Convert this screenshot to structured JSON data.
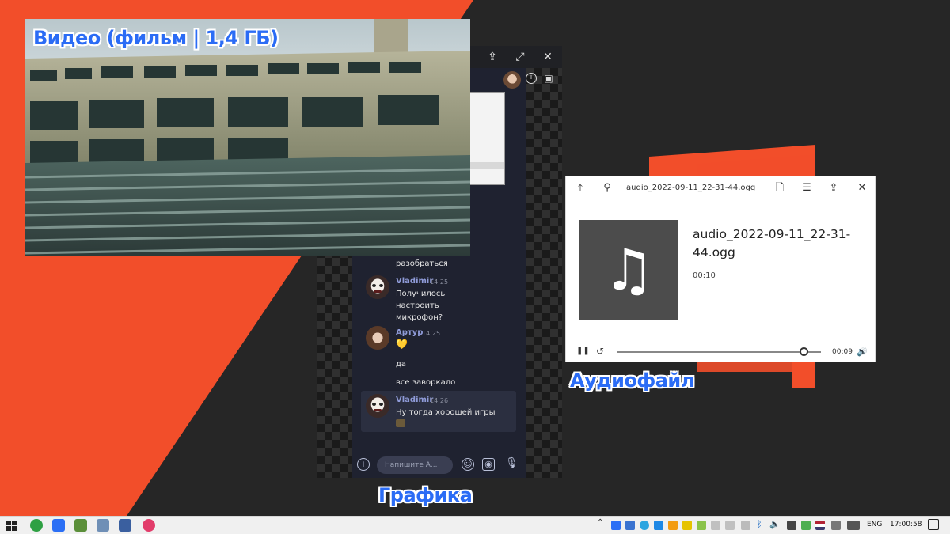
{
  "captions": {
    "video": "Видео (фильм | 1,4 ГБ)",
    "graphics": "Графика",
    "audio": "Аудиофайл"
  },
  "chat": {
    "messages": [
      {
        "type": "text",
        "text": "разобраться"
      },
      {
        "type": "group",
        "author": "Vladimir",
        "time": "14:25",
        "lines": [
          "Получилось",
          "настроить",
          "микрофон?"
        ]
      },
      {
        "type": "group",
        "author": "Артур",
        "time": "14:25",
        "lines": [
          "💛"
        ]
      },
      {
        "type": "text",
        "text": "да"
      },
      {
        "type": "text",
        "text": "все заворкало"
      },
      {
        "type": "group",
        "author": "Vladimir",
        "time": "14:26",
        "lines": [
          "Ну тогда хорошей игры"
        ]
      }
    ],
    "input_placeholder": "Напишите А..."
  },
  "audio_player": {
    "window_title": "audio_2022-09-11_22-31-44.ogg",
    "track_title": "audio_2022-09-11_22-31-44.ogg",
    "duration": "00:10",
    "elapsed": "00:09",
    "progress": 0.92
  },
  "taskbar": {
    "language": "ENG",
    "clock": "17:00:58"
  },
  "colors": {
    "accent_orange": "#f24e2a",
    "caption_blue": "#2b6cf5",
    "chat_bg": "#1f2230",
    "chat_author": "#8f9bd8"
  }
}
